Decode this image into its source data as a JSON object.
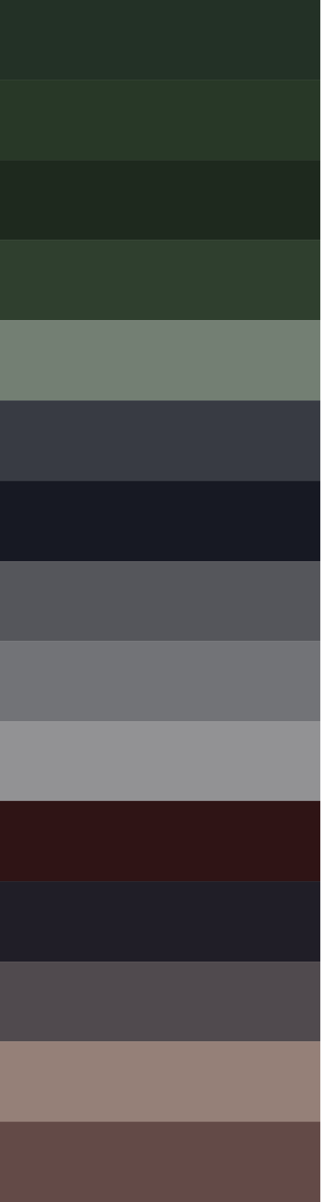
{
  "palette": {
    "swatches": [
      {
        "name": "swatch-1",
        "color": "#233126"
      },
      {
        "name": "swatch-2",
        "color": "#283827"
      },
      {
        "name": "swatch-3",
        "color": "#1e291e"
      },
      {
        "name": "swatch-4",
        "color": "#2f3f2e"
      },
      {
        "name": "swatch-5",
        "color": "#737f73"
      },
      {
        "name": "swatch-6",
        "color": "#383b43"
      },
      {
        "name": "swatch-7",
        "color": "#171923"
      },
      {
        "name": "swatch-8",
        "color": "#55565b"
      },
      {
        "name": "swatch-9",
        "color": "#727377"
      },
      {
        "name": "swatch-10",
        "color": "#929294"
      },
      {
        "name": "swatch-11",
        "color": "#2f1415"
      },
      {
        "name": "swatch-12",
        "color": "#201e27"
      },
      {
        "name": "swatch-13",
        "color": "#504a4e"
      },
      {
        "name": "swatch-14",
        "color": "#958078"
      },
      {
        "name": "swatch-15",
        "color": "#634a47"
      }
    ]
  }
}
